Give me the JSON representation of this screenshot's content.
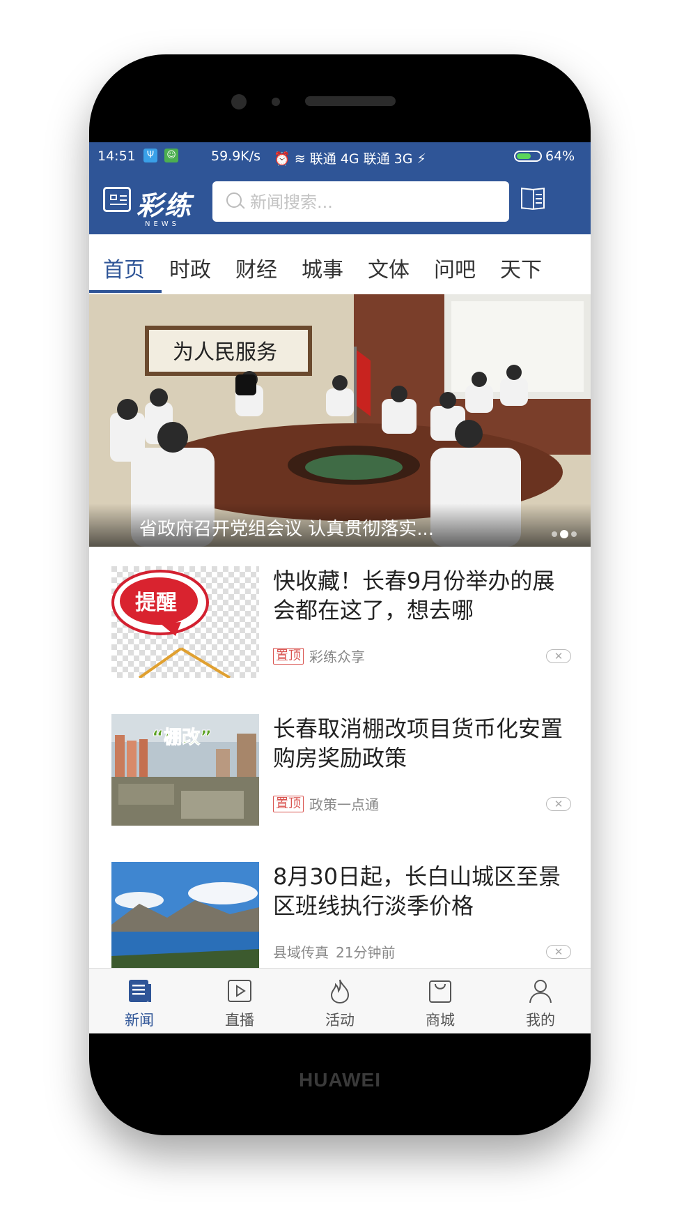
{
  "status_bar": {
    "time": "14:51",
    "speed": "59.9K/s",
    "network": "联通 4G  联通 3G",
    "battery": "64%",
    "battery_level": 0.64
  },
  "header": {
    "logo_text": "彩练",
    "logo_sub": "NEWS",
    "search_placeholder": "新闻搜索..."
  },
  "tabs": [
    {
      "label": "首页",
      "active": true
    },
    {
      "label": "时政"
    },
    {
      "label": "财经"
    },
    {
      "label": "城事"
    },
    {
      "label": "文体"
    },
    {
      "label": "问吧"
    },
    {
      "label": "天下"
    }
  ],
  "banner": {
    "caption": "省政府召开党组会议 认真贯彻落实...",
    "calligraphy": "为人民服务",
    "slide_count": 3,
    "active_slide": 2
  },
  "news": [
    {
      "title": "快收藏！长春9月份举办的展会都在这了，想去哪",
      "tag": "置顶",
      "source": "彩练众享",
      "thumb_text": "提醒"
    },
    {
      "title": "长春取消棚改项目货币化安置购房奖励政策",
      "tag": "置顶",
      "source": "政策一点通",
      "thumb_text": "“棚改”"
    },
    {
      "title": "8月30日起，长白山城区至景区班线执行淡季价格",
      "tag": "",
      "source": "县域传真",
      "time": "21分钟前"
    }
  ],
  "bottom_nav": [
    {
      "label": "新闻",
      "icon": "news-icon",
      "active": true
    },
    {
      "label": "直播",
      "icon": "play-icon"
    },
    {
      "label": "活动",
      "icon": "flame-icon"
    },
    {
      "label": "商城",
      "icon": "bag-icon"
    },
    {
      "label": "我的",
      "icon": "user-icon"
    }
  ],
  "device_brand": "HUAWEI",
  "colors": {
    "primary": "#2f5597",
    "pin_tag": "#d9534f"
  }
}
